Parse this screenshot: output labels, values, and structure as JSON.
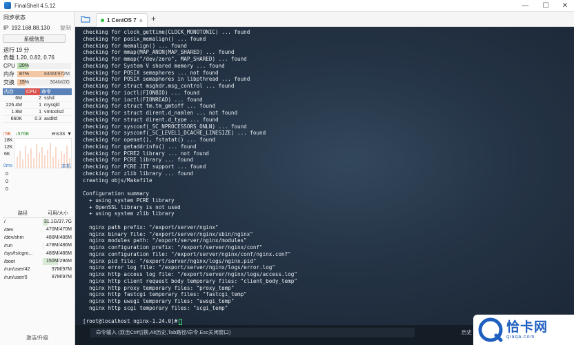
{
  "app": {
    "title": "FinalShell 4.5.12"
  },
  "window_controls": {
    "minimize": "—",
    "maximize": "☐",
    "close": "✕"
  },
  "sidebar": {
    "sync_status": "同步状态",
    "ip_label": "IP",
    "ip_value": "192.168.88.130",
    "copy_label": "复制",
    "sysinfo_button": "系统信息",
    "uptime": "运行 19 分",
    "load": "负载 1.20, 0.82, 0.76",
    "cpu": {
      "label": "CPU",
      "value": "20%",
      "percent": 20
    },
    "mem": {
      "label": "内存",
      "value": "87%",
      "detail": "846M/972M",
      "percent": 87
    },
    "swap": {
      "label": "交换",
      "value": "15%",
      "detail": "304M/2G",
      "percent": 15
    },
    "proc_headers": [
      "内存",
      "CPU",
      "命令"
    ],
    "processes": [
      {
        "mem": "6M",
        "cpu": "2",
        "cmd": "sshd"
      },
      {
        "mem": "226.4M",
        "cpu": "1",
        "cmd": "mysqld"
      },
      {
        "mem": "1.8M",
        "cpu": "1",
        "cmd": "vmtoolsd"
      },
      {
        "mem": "660K",
        "cpu": "0.3",
        "cmd": "auditd"
      }
    ],
    "net": {
      "up": "↑5K",
      "down": "↓576B",
      "iface": "ens33",
      "dropdown": "▼"
    },
    "graph_labels": [
      "18K",
      "12K",
      "6K"
    ],
    "latency": {
      "label": "0ms",
      "host": "本机",
      "values": [
        "0",
        "0",
        "0"
      ]
    },
    "disk_headers": [
      "路径",
      "可用/大小"
    ],
    "disks": [
      {
        "path": "/",
        "usage": "31.1G/37.7G",
        "percent": 17
      },
      {
        "path": "/dev",
        "usage": "470M/470M",
        "percent": 0
      },
      {
        "path": "/dev/shm",
        "usage": "486M/486M",
        "percent": 0
      },
      {
        "path": "/run",
        "usage": "478M/486M",
        "percent": 2
      },
      {
        "path": "/sys/fs/cgro...",
        "usage": "486M/486M",
        "percent": 0
      },
      {
        "path": "/boot",
        "usage": "150M/296M",
        "percent": 49
      },
      {
        "path": "/run/user/42",
        "usage": "97M/97M",
        "percent": 0
      },
      {
        "path": "/run/user/0",
        "usage": "97M/97M",
        "percent": 0
      }
    ],
    "activate_link": "激活/升级"
  },
  "tabs": [
    {
      "label": "1 CentOS 7",
      "close": "×"
    }
  ],
  "new_tab": "+",
  "terminal": {
    "lines": [
      "checking for clock_gettime(CLOCK_MONOTONIC) ... found",
      "checking for posix_memalign() ... found",
      "checking for memalign() ... found",
      "checking for mmap(MAP_ANON|MAP_SHARED) ... found",
      "checking for mmap(\"/dev/zero\", MAP_SHARED) ... found",
      "checking for System V shared memory ... found",
      "checking for POSIX semaphores ... not found",
      "checking for POSIX semaphores in libpthread ... found",
      "checking for struct msghdr.msg_control ... found",
      "checking for ioctl(FIONBIO) ... found",
      "checking for ioctl(FIONREAD) ... found",
      "checking for struct tm.tm_gmtoff ... found",
      "checking for struct dirent.d_namlen ... not found",
      "checking for struct dirent.d_type ... found",
      "checking for sysconf(_SC_NPROCESSORS_ONLN) ... found",
      "checking for sysconf(_SC_LEVEL1_DCACHE_LINESIZE) ... found",
      "checking for openat(), fstatat() ... found",
      "checking for getaddrinfo() ... found",
      "checking for PCRE2 library ... not found",
      "checking for PCRE library ... found",
      "checking for PCRE JIT support ... found",
      "checking for zlib library ... found",
      "creating objs/Makefile",
      "",
      "Configuration summary",
      "  + using system PCRE library",
      "  + OpenSSL library is not used",
      "  + using system zlib library",
      "",
      "  nginx path prefix: \"/export/server/nginx\"",
      "  nginx binary file: \"/export/server/nginx/sbin/nginx\"",
      "  nginx modules path: \"/export/server/nginx/modules\"",
      "  nginx configuration prefix: \"/export/server/nginx/conf\"",
      "  nginx configuration file: \"/export/server/nginx/conf/nginx.conf\"",
      "  nginx pid file: \"/export/server/nginx/logs/nginx.pid\"",
      "  nginx error log file: \"/export/server/nginx/logs/error.log\"",
      "  nginx http access log file: \"/export/server/nginx/logs/access.log\"",
      "  nginx http client request body temporary files: \"client_body_temp\"",
      "  nginx http proxy temporary files: \"proxy_temp\"",
      "  nginx http fastcgi temporary files: \"fastcgi_temp\"",
      "  nginx http uwsgi temporary files: \"uwsgi_temp\"",
      "  nginx http scgi temporary files: \"scgi_temp\"",
      ""
    ],
    "prompt": "[root@localhost nginx-1.24.0]#"
  },
  "command_bar": {
    "placeholder": "命令输入 (双击Ctrl切换,Alt历史,Tab路径/命令,Esc关闭窗口)",
    "history": "历史"
  },
  "watermark": {
    "main": "恰卡网",
    "sub": "qiaqa.com"
  },
  "colors": {
    "accent": "#5b82b8",
    "terminal_bg": "#243345",
    "cursor": "#3bd16f",
    "watermark": "#1f5fbf"
  }
}
